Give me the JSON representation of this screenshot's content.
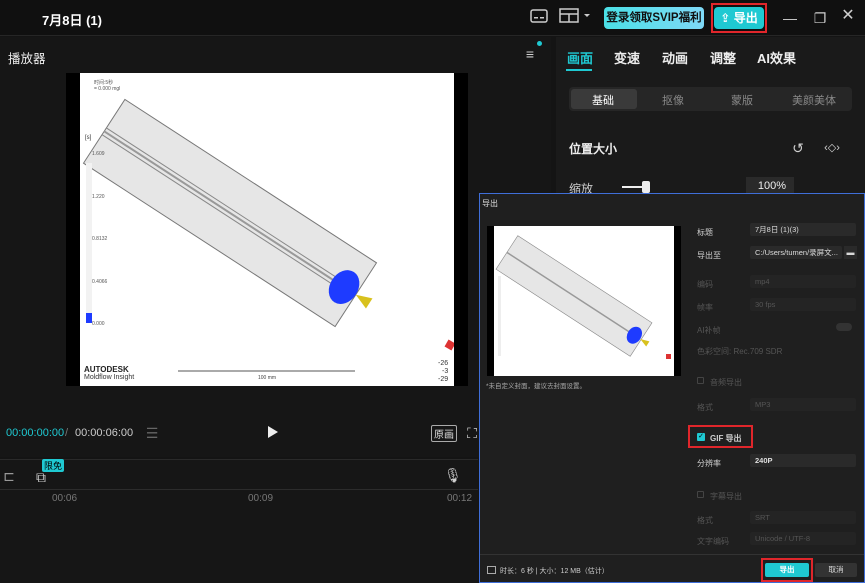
{
  "window": {
    "title": "7月8日 (1)",
    "svip_label": "登录领取SVIP福利",
    "export_label": "导出"
  },
  "player": {
    "title": "播放器",
    "time_current": "00:00:00:00",
    "time_sep": "/",
    "time_total": "00:00:06:00",
    "ratio_label": "原画",
    "video": {
      "brand": "AUTODESK",
      "product": "Moldflow Insight",
      "legend_unit": "[s]",
      "legend_values": [
        "1.609",
        "1.220",
        "0.8132",
        "0.4066",
        "0.000"
      ],
      "scale_label": "100 mm",
      "coord_values": [
        "-26",
        "-3",
        "-29"
      ],
      "corner_text": [
        "时间:5秒",
        "= 0.000 mgl"
      ]
    }
  },
  "timeline": {
    "badge": "限免",
    "ticks": [
      "00:06",
      "00:09",
      "00:12"
    ]
  },
  "inspector": {
    "tabs": [
      "画面",
      "变速",
      "动画",
      "调整",
      "AI效果"
    ],
    "subtabs": [
      "基础",
      "抠像",
      "蒙版",
      "美颜美体"
    ],
    "section": "位置大小",
    "scale_label": "缩放",
    "scale_value": "100%"
  },
  "export_dialog": {
    "title": "导出",
    "cover_note": "*未自定义封面，建议去封面设置。",
    "fields": {
      "title_label": "标题",
      "title_value": "7月8日 (1)(3)",
      "path_label": "导出至",
      "path_value": "C:/Users/tumen/录屏文...",
      "codec_label": "编码",
      "codec_value": "mp4",
      "fps_label": "帧率",
      "fps_value": "30 fps",
      "ai_label": "AI补帧",
      "color_label": "色彩空间: Rec.709 SDR",
      "audio_label": "音频导出",
      "audio_format_label": "格式",
      "audio_format_value": "MP3",
      "gif_label": "GIF 导出",
      "res_label": "分辨率",
      "res_value": "240P",
      "subtitle_label": "字幕导出",
      "sub_format_label": "格式",
      "sub_format_value": "SRT",
      "sub_enc_label": "文字编码",
      "sub_enc_value": "Unicode / UTF-8"
    },
    "footer": {
      "info": "时长：6 秒 | 大小：12 MB（估计）",
      "export": "导出",
      "cancel": "取消"
    }
  }
}
